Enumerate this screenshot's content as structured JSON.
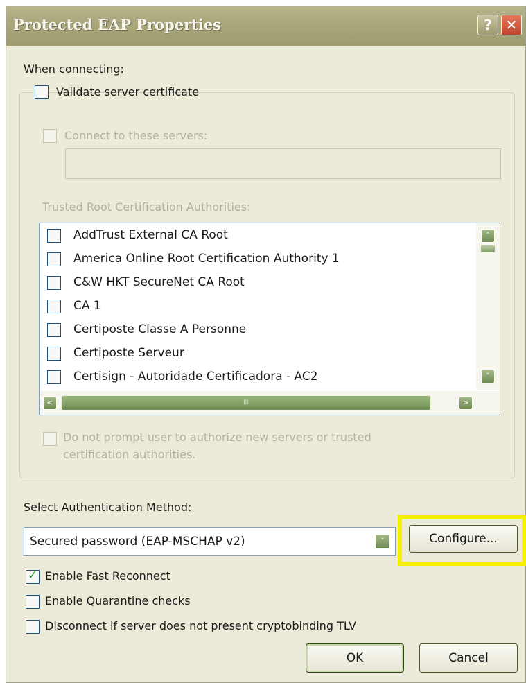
{
  "window": {
    "title": "Protected EAP Properties",
    "help_glyph": "?",
    "close_glyph": "✕"
  },
  "when_connecting": "When connecting:",
  "validate_cert": {
    "label": "Validate server certificate",
    "checked": false
  },
  "connect_servers": {
    "label": "Connect to these servers:",
    "checked": false,
    "enabled": false,
    "value": ""
  },
  "trusted_label": "Trusted Root Certification Authorities:",
  "authorities": [
    {
      "name": "AddTrust External CA Root",
      "checked": false
    },
    {
      "name": "America Online Root Certification Authority 1",
      "checked": false
    },
    {
      "name": "C&W HKT SecureNet CA Root",
      "checked": false
    },
    {
      "name": "CA 1",
      "checked": false
    },
    {
      "name": "Certiposte Classe A Personne",
      "checked": false
    },
    {
      "name": "Certiposte Serveur",
      "checked": false
    },
    {
      "name": "Certisign - Autoridade Certificadora - AC2",
      "checked": false
    }
  ],
  "scroll": {
    "up": "˄",
    "down": "˅",
    "left": "<",
    "right": ">",
    "grip": "III"
  },
  "no_prompt": {
    "line1": "Do not prompt user to authorize new servers or trusted",
    "line2": "certification authorities.",
    "checked": false,
    "enabled": false
  },
  "auth_method_label": "Select Authentication Method:",
  "auth_method": {
    "value": "Secured password (EAP-MSCHAP v2)",
    "drop_glyph": "˅"
  },
  "configure_button": "Configure...",
  "fast_reconnect": {
    "label": "Enable Fast Reconnect",
    "checked": true,
    "mark": "✓"
  },
  "quarantine": {
    "label": "Enable Quarantine checks",
    "checked": false
  },
  "cryptobinding": {
    "label": "Disconnect if server does not present cryptobinding TLV",
    "checked": false
  },
  "ok_button": "OK",
  "cancel_button": "Cancel",
  "colors": {
    "highlight": "#f5f000",
    "title_bar": "#a9a67c",
    "check_mark": "#21a121"
  }
}
